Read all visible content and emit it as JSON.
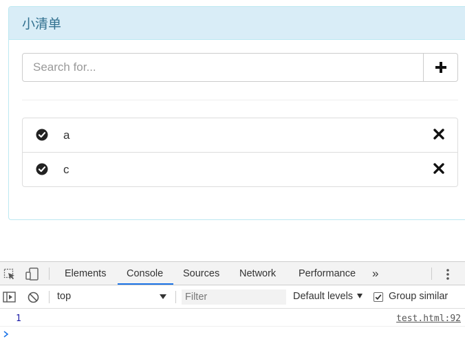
{
  "panel": {
    "title": "小清单",
    "search_placeholder": "Search for...",
    "add_icon": "plus-icon",
    "items": [
      {
        "text": "a",
        "status_icon": "check-circle-icon",
        "remove_icon": "remove-icon"
      },
      {
        "text": "c",
        "status_icon": "check-circle-icon",
        "remove_icon": "remove-icon"
      }
    ]
  },
  "devtools": {
    "tabs": [
      "Elements",
      "Console",
      "Sources",
      "Network",
      "Performance"
    ],
    "active_tab": "Console",
    "more_tabs": "»",
    "context": "top",
    "filter_placeholder": "Filter",
    "levels": "Default levels",
    "group_similar": "Group similar",
    "group_similar_checked": true,
    "messages": [
      {
        "value": "1",
        "source": "test.html:92"
      }
    ],
    "accent_color": "#1a73e8"
  }
}
